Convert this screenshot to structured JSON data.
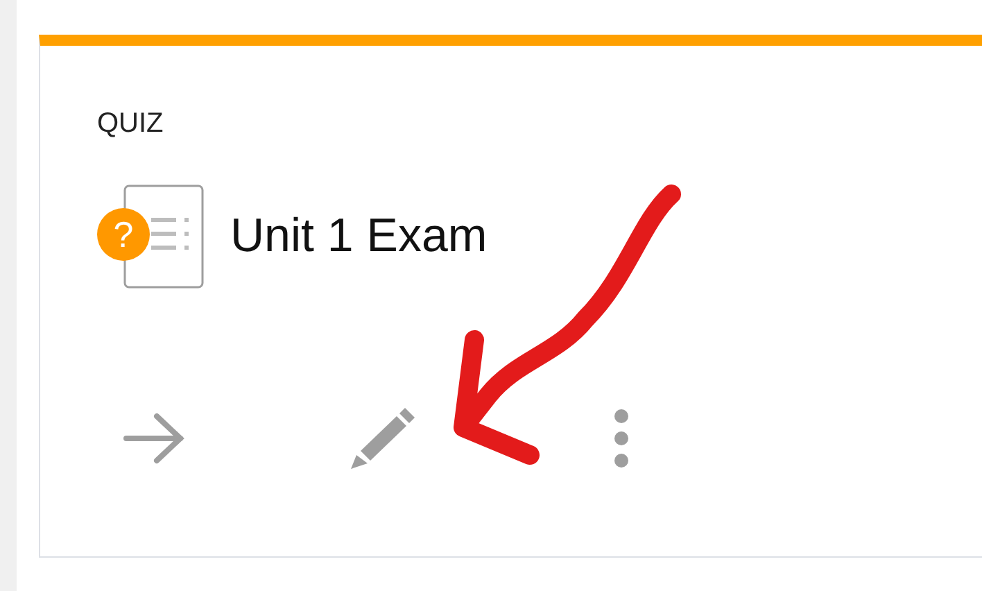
{
  "card": {
    "type_label": "QUIZ",
    "title": "Unit 1 Exam",
    "badge": "?"
  }
}
